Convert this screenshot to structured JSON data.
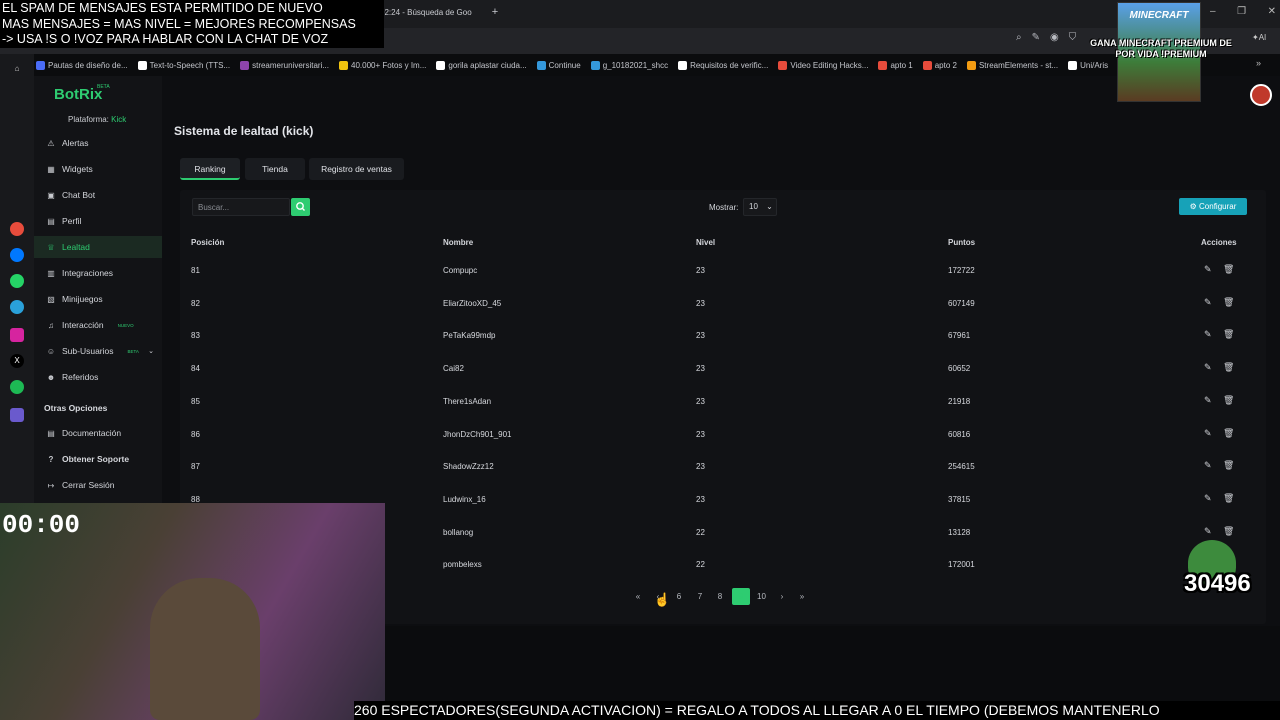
{
  "browser": {
    "tab_title": "Búsqueda de Goo",
    "tab_time": "02:24",
    "ai_label": "AI",
    "bookmarks": [
      {
        "label": "Pautas de diseño de...",
        "color": "#4a6cf7"
      },
      {
        "label": "Text-to-Speech (TTS...",
        "color": "#ffffff"
      },
      {
        "label": "streameruniversitari...",
        "color": "#8e44ad"
      },
      {
        "label": "40.000+ Fotos y Im...",
        "color": "#f1c40f"
      },
      {
        "label": "gorila aplastar ciuda...",
        "color": "#ffffff"
      },
      {
        "label": "Continue",
        "color": "#3498db"
      },
      {
        "label": "g_10182021_shcc",
        "color": "#3498db"
      },
      {
        "label": "Requisitos de verific...",
        "color": "#ffffff"
      },
      {
        "label": "Video Editing Hacks...",
        "color": "#e74c3c"
      },
      {
        "label": "apto 1",
        "color": "#e74c3c"
      },
      {
        "label": "apto 2",
        "color": "#e74c3c"
      },
      {
        "label": "StreamElements - st...",
        "color": "#f39c12"
      },
      {
        "label": "Uni/Aris",
        "color": "#ffffff"
      }
    ]
  },
  "sidebar": {
    "logo": "BotRix",
    "logo_badge": "BETA",
    "platform_label": "Plataforma:",
    "platform_value": "Kick",
    "items": [
      {
        "label": "Alertas",
        "icon": "⚠"
      },
      {
        "label": "Widgets",
        "icon": "▦"
      },
      {
        "label": "Chat Bot",
        "icon": "▣"
      },
      {
        "label": "Perfil",
        "icon": "▤"
      },
      {
        "label": "Lealtad",
        "icon": "♕"
      },
      {
        "label": "Integraciones",
        "icon": "▥"
      },
      {
        "label": "Minijuegos",
        "icon": "▧"
      },
      {
        "label": "Interacción",
        "icon": "♫"
      },
      {
        "label": "Sub-Usuarios",
        "icon": "☺"
      },
      {
        "label": "Referidos",
        "icon": "☻"
      }
    ],
    "tag_nuevo": "NUEVO",
    "tag_beta": "BETA",
    "otras_title": "Otras Opciones",
    "otras_items": [
      {
        "label": "Documentación",
        "icon": "▤"
      },
      {
        "label": "Obtener Soporte",
        "icon": "?"
      },
      {
        "label": "Cerrar Sesión",
        "icon": "↦"
      }
    ]
  },
  "main": {
    "title": "Sistema de lealtad (kick)",
    "tabs": [
      "Ranking",
      "Tienda",
      "Registro de ventas"
    ],
    "search_placeholder": "Buscar...",
    "mostrar_label": "Mostrar:",
    "mostrar_value": "10",
    "configurar_label": "Configurar",
    "columns": [
      "Posición",
      "Nombre",
      "Nivel",
      "Puntos",
      "Acciones"
    ],
    "rows": [
      {
        "pos": "81",
        "name": "Compupc",
        "level": "23",
        "points": "172722"
      },
      {
        "pos": "82",
        "name": "EliarZitooXD_45",
        "level": "23",
        "points": "607149"
      },
      {
        "pos": "83",
        "name": "PeTaKa99mdp",
        "level": "23",
        "points": "67961"
      },
      {
        "pos": "84",
        "name": "Cai82",
        "level": "23",
        "points": "60652"
      },
      {
        "pos": "85",
        "name": "There1sAdan",
        "level": "23",
        "points": "21918"
      },
      {
        "pos": "86",
        "name": "JhonDzCh901_901",
        "level": "23",
        "points": "60816"
      },
      {
        "pos": "87",
        "name": "ShadowZzz12",
        "level": "23",
        "points": "254615"
      },
      {
        "pos": "88",
        "name": "Ludwinx_16",
        "level": "23",
        "points": "37815"
      },
      {
        "pos": "",
        "name": "bollanog",
        "level": "22",
        "points": "13128"
      },
      {
        "pos": "",
        "name": "pombelexs",
        "level": "22",
        "points": "172001"
      }
    ],
    "pagination": [
      "«",
      "‹",
      "6",
      "7",
      "8",
      "9",
      "10",
      "›",
      "»"
    ],
    "current_page": "9"
  },
  "overlays": {
    "top_lines": [
      "EL SPAM DE MENSAJES ESTA PERMITIDO DE NUEVO",
      "MAS MENSAJES = MAS NIVEL = MEJORES RECOMPENSAS",
      "-> USA !S O !VOZ PARA HABLAR CON LA CHAT DE VOZ"
    ],
    "mc_title": "MINECRAFT",
    "mc_text": "GANA MINECRAFT PREMIUM DE POR VIDA !PREMIUM",
    "timer": "00:00",
    "counter": "30496",
    "ticker": "260 ESPECTADORES(SEGUNDA ACTIVACION) = REGALO A TODOS AL LLEGAR A 0 EL TIEMPO (DEBEMOS MANTENERLO"
  }
}
